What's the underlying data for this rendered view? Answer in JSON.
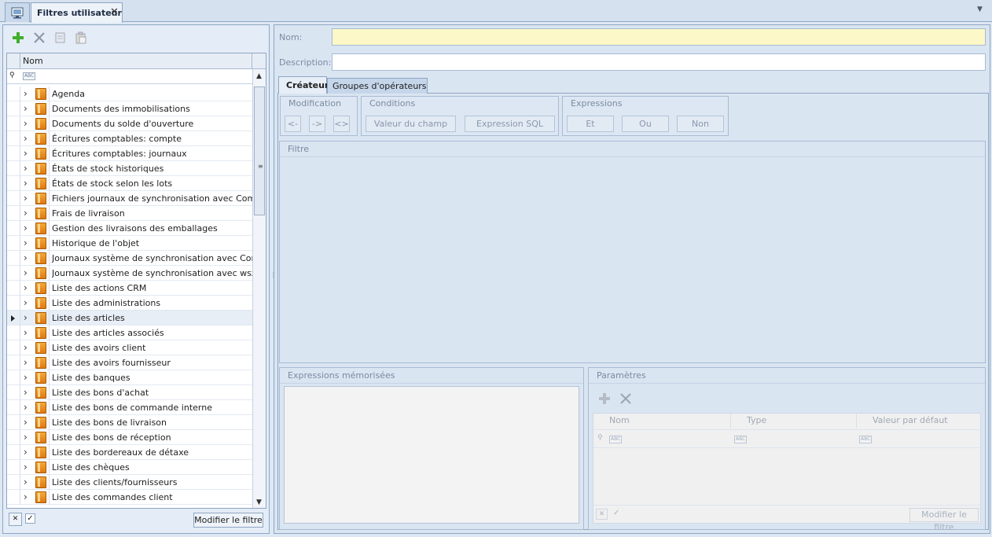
{
  "tab": {
    "label": "Filtres utilisateur",
    "close": "✕"
  },
  "left": {
    "toolbar": {
      "add": "+",
      "delete": "✕"
    },
    "grid": {
      "column": "Nom",
      "rows": [
        "Agenda",
        "Documents des immobilisations",
        "Documents du solde d'ouverture",
        "Écritures comptables: compte",
        "Écritures comptables: journaux",
        "États de stock historiques",
        "États de stock selon les lots",
        "Fichiers journaux de synchronisation avec Com...",
        "Frais de livraison",
        "Gestion des livraisons des emballages",
        "Historique de l'objet",
        "Journaux système de synchronisation avec Com...",
        "Journaux système de synchronisation avec wsz...",
        "Liste des actions CRM",
        "Liste des administrations",
        "Liste des articles",
        "Liste des articles associés",
        "Liste des avoirs client",
        "Liste des avoirs fournisseur",
        "Liste des banques",
        "Liste des bons d'achat",
        "Liste des bons de commande interne",
        "Liste des bons de livraison",
        "Liste des bons de réception",
        "Liste des bordereaux de détaxe",
        "Liste des chèques",
        "Liste des clients/fournisseurs",
        "Liste des commandes client"
      ],
      "selected_index": 15
    },
    "footer": {
      "clear": "✕",
      "check": "✓",
      "modify": "Modifier le filtre"
    }
  },
  "right": {
    "nom_label": "Nom:",
    "description_label": "Description:",
    "tabs": [
      "Créateur",
      "Groupes d'opérateurs"
    ],
    "modification": {
      "title": "Modification",
      "buttons": [
        "<-",
        "->",
        "<>"
      ]
    },
    "conditions": {
      "title": "Conditions",
      "buttons": [
        "Valeur du champ",
        "Expression SQL"
      ]
    },
    "expressions": {
      "title": "Expressions",
      "buttons": [
        "Et",
        "Ou",
        "Non"
      ]
    },
    "filtre_title": "Filtre",
    "memorized_title": "Expressions mémorisées",
    "params": {
      "title": "Paramètres",
      "columns": [
        "Nom",
        "Type",
        "Valeur par défaut"
      ],
      "modify": "Modifier le filtre",
      "clear": "✕",
      "check": "✓"
    }
  },
  "abc": "ABC"
}
